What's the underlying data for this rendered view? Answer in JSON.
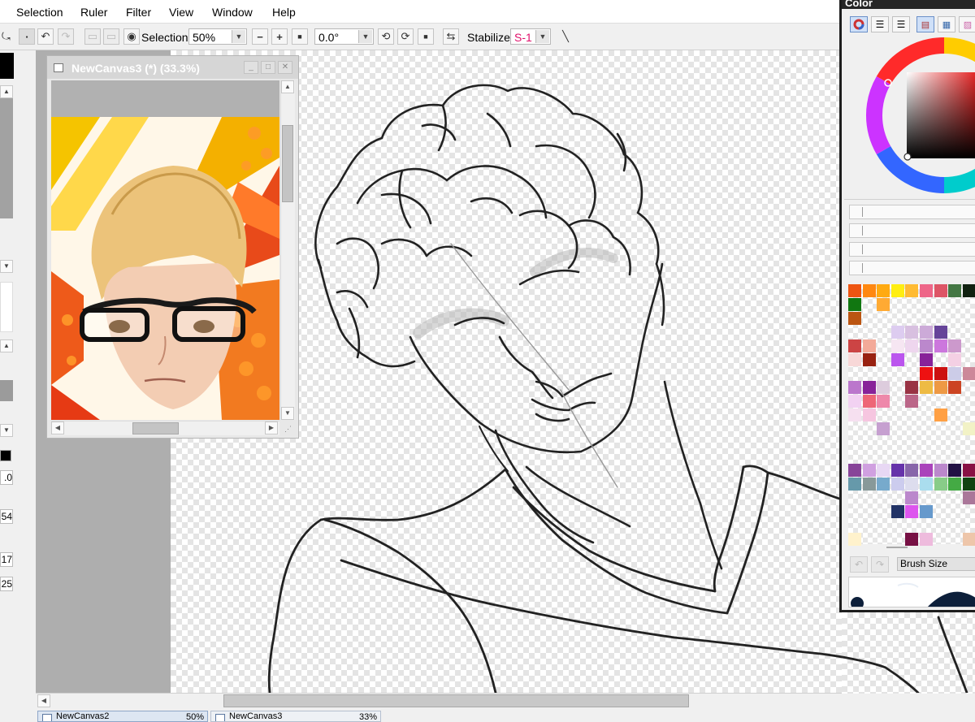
{
  "menu": [
    "Selection",
    "Ruler",
    "Filter",
    "View",
    "Window",
    "Help"
  ],
  "toolbar": {
    "selection_label": "Selection",
    "zoom_value": "50%",
    "zoom_minus": "−",
    "zoom_plus": "+",
    "zoom_reset": "■",
    "rotation_value": "0.0°",
    "stabilizer_label": "Stabilizer",
    "stabilizer_value": "S-1"
  },
  "left_panel": {
    "values": [
      ".0",
      "54",
      "17",
      "25"
    ]
  },
  "nav_window": {
    "title": "NewCanvas3 (*) (33.3%)"
  },
  "color_panel": {
    "title": "Color",
    "brush_size_label": "Brush Size",
    "selected_color": "#cc0000",
    "swatches": [
      {
        "r": 0,
        "c": 0,
        "color": "#ee5511"
      },
      {
        "r": 0,
        "c": 1,
        "color": "#ff8811"
      },
      {
        "r": 0,
        "c": 2,
        "color": "#ffaa11"
      },
      {
        "r": 0,
        "c": 3,
        "color": "#ffee11"
      },
      {
        "r": 0,
        "c": 4,
        "color": "#ffbb33"
      },
      {
        "r": 0,
        "c": 5,
        "color": "#ee6688"
      },
      {
        "r": 0,
        "c": 6,
        "color": "#dd5566"
      },
      {
        "r": 0,
        "c": 7,
        "color": "#447744"
      },
      {
        "r": 0,
        "c": 8,
        "color": "#112211"
      },
      {
        "r": 1,
        "c": 0,
        "color": "#117711"
      },
      {
        "r": 1,
        "c": 2,
        "color": "#ffaa33"
      },
      {
        "r": 2,
        "c": 0,
        "color": "#bb5511"
      },
      {
        "r": 3,
        "c": 3,
        "color": "#ddccf0"
      },
      {
        "r": 3,
        "c": 4,
        "color": "#d8c0e0"
      },
      {
        "r": 3,
        "c": 5,
        "color": "#ccaad8"
      },
      {
        "r": 3,
        "c": 6,
        "color": "#664499"
      },
      {
        "r": 4,
        "c": 0,
        "color": "#cc4444"
      },
      {
        "r": 4,
        "c": 1,
        "color": "#f3aa99"
      },
      {
        "r": 4,
        "c": 3,
        "color": "#f6e6f2"
      },
      {
        "r": 4,
        "c": 4,
        "color": "#eed6ee"
      },
      {
        "r": 4,
        "c": 5,
        "color": "#bb88cc"
      },
      {
        "r": 4,
        "c": 6,
        "color": "#cc77dd"
      },
      {
        "r": 4,
        "c": 7,
        "color": "#cc99cc"
      },
      {
        "r": 5,
        "c": 0,
        "color": "#f8d8d8"
      },
      {
        "r": 5,
        "c": 1,
        "color": "#992211"
      },
      {
        "r": 5,
        "c": 3,
        "color": "#bb55ee"
      },
      {
        "r": 5,
        "c": 5,
        "color": "#882299"
      },
      {
        "r": 5,
        "c": 7,
        "color": "#f4d0e4"
      },
      {
        "r": 6,
        "c": 5,
        "color": "#ee1111"
      },
      {
        "r": 6,
        "c": 6,
        "color": "#cc1111"
      },
      {
        "r": 6,
        "c": 7,
        "color": "#cccce8"
      },
      {
        "r": 6,
        "c": 8,
        "color": "#cc8899"
      },
      {
        "r": 7,
        "c": 0,
        "color": "#bb77cc"
      },
      {
        "r": 7,
        "c": 1,
        "color": "#882299"
      },
      {
        "r": 7,
        "c": 2,
        "color": "#ddccdd"
      },
      {
        "r": 7,
        "c": 4,
        "color": "#993344"
      },
      {
        "r": 7,
        "c": 5,
        "color": "#eebb44"
      },
      {
        "r": 7,
        "c": 6,
        "color": "#ee9944"
      },
      {
        "r": 7,
        "c": 7,
        "color": "#cc4422"
      },
      {
        "r": 8,
        "c": 0,
        "color": "#f2d2f2"
      },
      {
        "r": 8,
        "c": 1,
        "color": "#ee6677"
      },
      {
        "r": 8,
        "c": 2,
        "color": "#ee88aa"
      },
      {
        "r": 8,
        "c": 4,
        "color": "#bb6688"
      },
      {
        "r": 9,
        "c": 0,
        "color": "#f6e0f0"
      },
      {
        "r": 9,
        "c": 1,
        "color": "#f6c6e0"
      },
      {
        "r": 9,
        "c": 6,
        "color": "#ffa044"
      },
      {
        "r": 10,
        "c": 2,
        "color": "#c6a0d0"
      },
      {
        "r": 10,
        "c": 8,
        "color": "#f2f2c6"
      },
      {
        "r": 13,
        "c": 0,
        "color": "#884499"
      },
      {
        "r": 13,
        "c": 1,
        "color": "#d0a0e0"
      },
      {
        "r": 13,
        "c": 2,
        "color": "#e8d8f4"
      },
      {
        "r": 13,
        "c": 3,
        "color": "#6633aa"
      },
      {
        "r": 13,
        "c": 4,
        "color": "#8866aa"
      },
      {
        "r": 13,
        "c": 5,
        "color": "#aa44bb"
      },
      {
        "r": 13,
        "c": 6,
        "color": "#bb88cc"
      },
      {
        "r": 13,
        "c": 7,
        "color": "#221144"
      },
      {
        "r": 13,
        "c": 8,
        "color": "#881144"
      },
      {
        "r": 14,
        "c": 0,
        "color": "#6699aa"
      },
      {
        "r": 14,
        "c": 1,
        "color": "#889999"
      },
      {
        "r": 14,
        "c": 2,
        "color": "#77aacc"
      },
      {
        "r": 14,
        "c": 3,
        "color": "#ccccee"
      },
      {
        "r": 14,
        "c": 4,
        "color": "#ddddee"
      },
      {
        "r": 14,
        "c": 5,
        "color": "#aaddee"
      },
      {
        "r": 14,
        "c": 6,
        "color": "#88cc88"
      },
      {
        "r": 14,
        "c": 7,
        "color": "#44aa44"
      },
      {
        "r": 14,
        "c": 8,
        "color": "#114411"
      },
      {
        "r": 15,
        "c": 4,
        "color": "#bb88cc"
      },
      {
        "r": 15,
        "c": 8,
        "color": "#aa7799"
      },
      {
        "r": 16,
        "c": 3,
        "color": "#223366"
      },
      {
        "r": 16,
        "c": 4,
        "color": "#dd55ee"
      },
      {
        "r": 16,
        "c": 5,
        "color": "#6699cc"
      },
      {
        "r": 18,
        "c": 0,
        "color": "#fff2cc"
      },
      {
        "r": 18,
        "c": 4,
        "color": "#771144"
      },
      {
        "r": 18,
        "c": 5,
        "color": "#eebbdd"
      },
      {
        "r": 18,
        "c": 8,
        "color": "#eec6aa"
      }
    ]
  },
  "tabs": [
    {
      "label": "NewCanvas2",
      "percent": "50%"
    },
    {
      "label": "NewCanvas3",
      "percent": "33%"
    }
  ]
}
